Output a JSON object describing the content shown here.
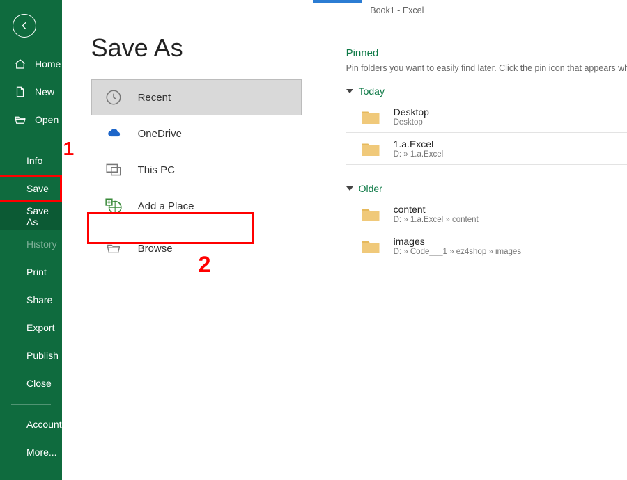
{
  "titlebar": {
    "text": "Book1  -  Excel"
  },
  "page": {
    "title": "Save As"
  },
  "sidebar": {
    "nav1": [
      {
        "label": "Home",
        "icon": "home"
      },
      {
        "label": "New",
        "icon": "new"
      },
      {
        "label": "Open",
        "icon": "open"
      }
    ],
    "nav2": [
      {
        "label": "Info",
        "selected": false,
        "dim": false
      },
      {
        "label": "Save",
        "selected": false,
        "dim": false
      },
      {
        "label": "Save As",
        "selected": true,
        "dim": false
      },
      {
        "label": "History",
        "selected": false,
        "dim": true
      },
      {
        "label": "Print",
        "selected": false,
        "dim": false
      },
      {
        "label": "Share",
        "selected": false,
        "dim": false
      },
      {
        "label": "Export",
        "selected": false,
        "dim": false
      },
      {
        "label": "Publish",
        "selected": false,
        "dim": false
      },
      {
        "label": "Close",
        "selected": false,
        "dim": false
      }
    ],
    "nav3": [
      {
        "label": "Account"
      },
      {
        "label": "More..."
      }
    ]
  },
  "locations": [
    {
      "label": "Recent",
      "icon": "clock",
      "selected": true
    },
    {
      "label": "OneDrive",
      "icon": "cloud",
      "selected": false
    },
    {
      "label": "This PC",
      "icon": "pc",
      "selected": false
    },
    {
      "label": "Add a Place",
      "icon": "addplace",
      "selected": false
    },
    {
      "label": "Browse",
      "icon": "browse",
      "selected": false
    }
  ],
  "pinned": {
    "heading": "Pinned",
    "desc": "Pin folders you want to easily find later. Click the pin icon that appears when you hover over a folder."
  },
  "groups": [
    {
      "heading": "Today",
      "folders": [
        {
          "name": "Desktop",
          "path": "Desktop"
        },
        {
          "name": "1.a.Excel",
          "path": "D: » 1.a.Excel"
        }
      ]
    },
    {
      "heading": "Older",
      "folders": [
        {
          "name": "content",
          "path": "D: » 1.a.Excel » content"
        },
        {
          "name": "images",
          "path": "D: » Code___1 » ez4shop » images"
        }
      ]
    }
  ],
  "annotations": {
    "n1": "1",
    "n2": "2"
  }
}
